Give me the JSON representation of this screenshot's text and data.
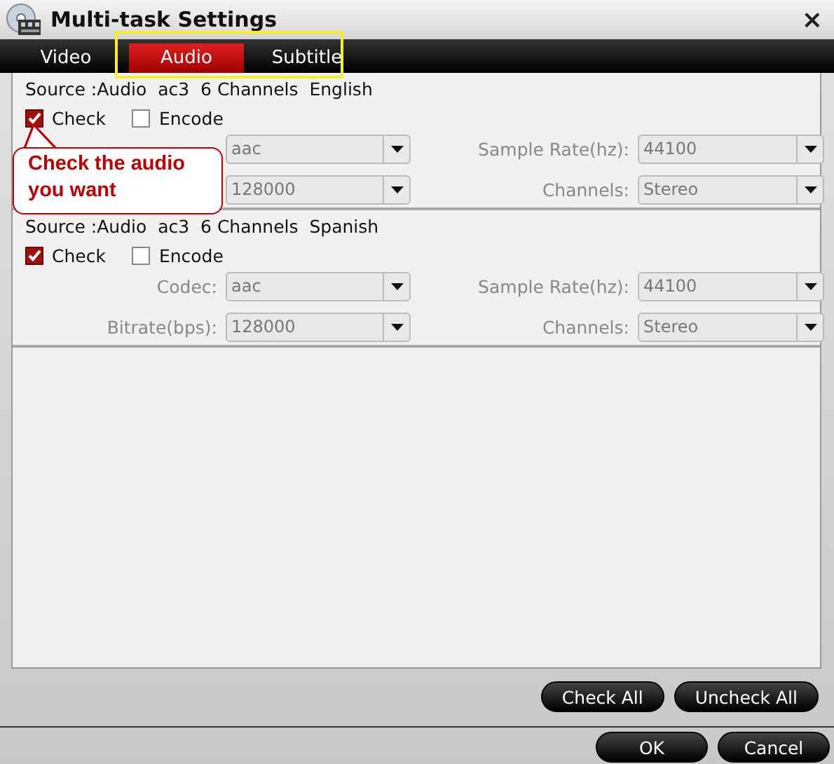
{
  "window": {
    "title": "Multi-task Settings",
    "close": "×"
  },
  "tabs": [
    {
      "label": "Video",
      "selected": false
    },
    {
      "label": "Audio",
      "selected": true
    },
    {
      "label": "Subtitle",
      "selected": false
    }
  ],
  "tracks": [
    {
      "source": "Source :Audio  ac3  6 Channels  English",
      "check": {
        "label": "Check",
        "checked": true
      },
      "encode": {
        "label": "Encode",
        "checked": false
      },
      "fields": [
        {
          "value": "aac",
          "disabled": true
        },
        {
          "label": "Sample Rate(hz):",
          "value": "44100",
          "disabled": true
        },
        {
          "value": "128000",
          "disabled": true
        },
        {
          "label": "Channels:",
          "value": "Stereo",
          "disabled": true
        }
      ]
    },
    {
      "source": "Source :Audio  ac3  6 Channels  Spanish",
      "check": {
        "label": "Check",
        "checked": true
      },
      "encode": {
        "label": "Encode",
        "checked": false
      },
      "fields": [
        {
          "label": "Codec:",
          "value": "aac",
          "disabled": true
        },
        {
          "label": "Sample Rate(hz):",
          "value": "44100",
          "disabled": true
        },
        {
          "label": "Bitrate(bps):",
          "value": "128000",
          "disabled": true
        },
        {
          "label": "Channels:",
          "value": "Stereo",
          "disabled": true
        }
      ]
    }
  ],
  "callout": {
    "text": "Check the audio you want"
  },
  "list_buttons": [
    "Check All",
    "Uncheck All"
  ],
  "dialog_buttons": [
    "OK",
    "Cancel"
  ]
}
